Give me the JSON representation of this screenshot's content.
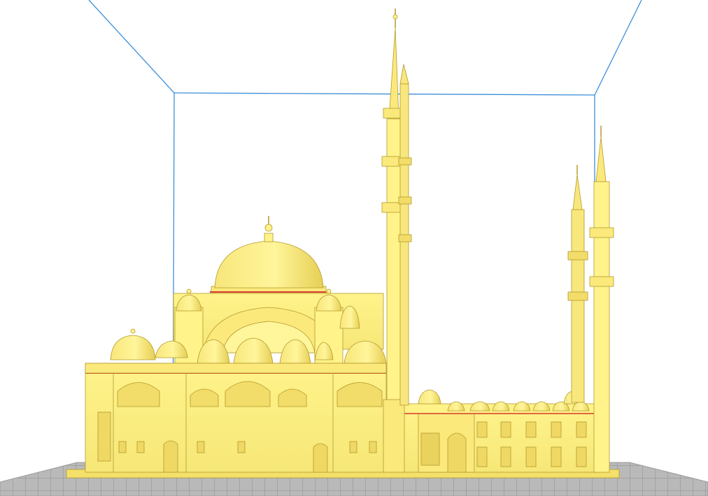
{
  "viewport": {
    "kind": "3d-slicer-preview",
    "background_color": "#ffffff",
    "build_volume_edge_color": "#3d8fd8",
    "build_plate_color": "#b9b9b9",
    "build_plate_grid_color": "#8d8d8d",
    "model_color": "#fff38a",
    "model_shade_color": "#e9d35a",
    "model_outline_color": "#b49a2d",
    "model_accent_color": "#d53a2b"
  },
  "model": {
    "subject": "mosque-model",
    "dome_count_visible": 26,
    "minaret_count_visible": 4
  }
}
